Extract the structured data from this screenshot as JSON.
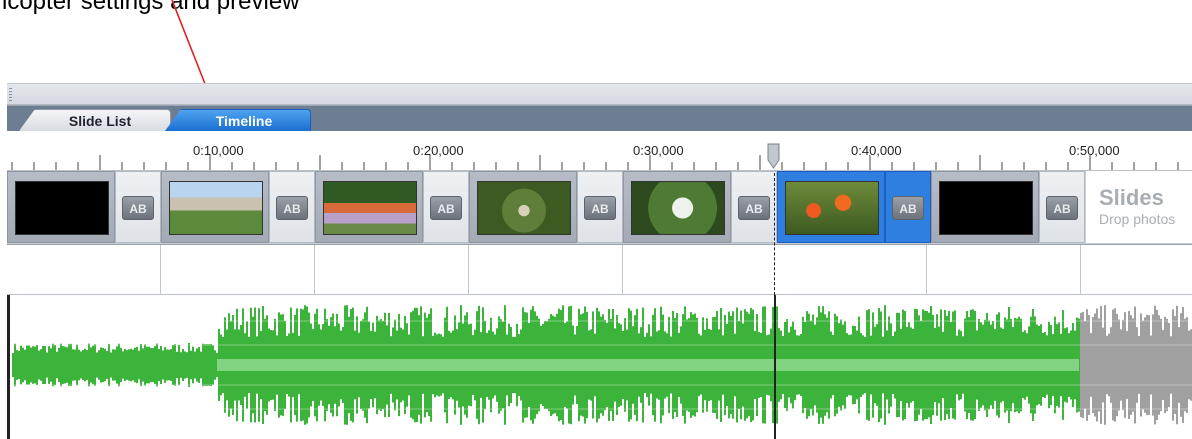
{
  "caption": {
    "text": "icopter settings and preview"
  },
  "tabs": [
    {
      "label": "Slide List",
      "active": false
    },
    {
      "label": "Timeline",
      "active": true
    }
  ],
  "ruler": {
    "labels": [
      "0:10,000",
      "0:20,000",
      "0:30,000",
      "0:40,000",
      "0:50,000"
    ]
  },
  "slides": {
    "transition_icon_label": "AB",
    "drop_zone": {
      "title": "Slides",
      "subtitle": "Drop photos"
    }
  },
  "colors": {
    "accent": "#2f7fe0",
    "waveform_active": "#3cb43c",
    "waveform_inactive": "#a0a0a0",
    "annotation_arrow": "#e0201c"
  }
}
